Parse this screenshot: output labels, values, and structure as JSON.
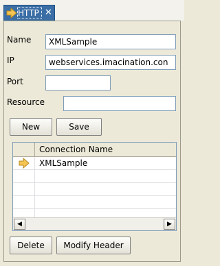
{
  "tab": {
    "label": "HTTP",
    "close": "✕"
  },
  "form": {
    "name_label": "Name",
    "name_value": "XMLSample",
    "ip_label": "IP",
    "ip_value": "webservices.imacination.con",
    "port_label": "Port",
    "port_value": "",
    "resource_label": "Resource",
    "resource_value": ""
  },
  "buttons": {
    "new": "New",
    "save": "Save",
    "delete": "Delete",
    "modify_header": "Modify Header"
  },
  "table": {
    "columns": [
      "",
      "Connection Name"
    ],
    "rows": [
      {
        "selected_marker": "arrow-right-icon",
        "name": "XMLSample"
      },
      {
        "name": ""
      },
      {
        "name": ""
      },
      {
        "name": ""
      },
      {
        "name": ""
      }
    ]
  },
  "scroll": {
    "left": "◀",
    "right": "▶"
  },
  "colors": {
    "tab_bg": "#3a6ea5",
    "arrow": "#f6c453",
    "panel_bg": "#ece9d8"
  }
}
